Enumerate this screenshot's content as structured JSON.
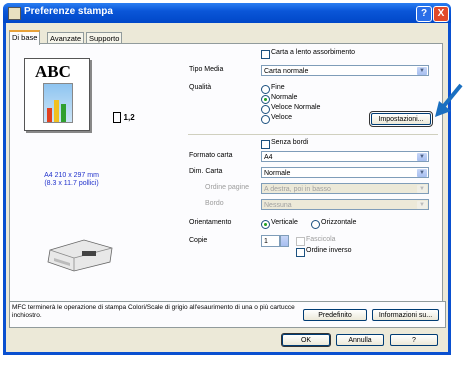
{
  "window": {
    "title": "Preferenze stampa",
    "help": "?",
    "close": "X"
  },
  "tabs": [
    {
      "label": "Di base"
    },
    {
      "label": "Avanzate"
    },
    {
      "label": "Supporto"
    }
  ],
  "preview": {
    "text": "ABC",
    "copies_badge": "1,2",
    "paper_size_line1": "A4 210 x 297 mm",
    "paper_size_line2": "(8.3 x 11.7 pollici)"
  },
  "form": {
    "slow_dry_label": "Carta a lento assorbimento",
    "media_type_label": "Tipo Media",
    "media_type_value": "Carta normale",
    "quality_label": "Qualità",
    "quality_options": [
      "Fine",
      "Normale",
      "Veloce Normale",
      "Veloce"
    ],
    "quality_selected": "Normale",
    "settings_button": "Impostazioni...",
    "borderless_label": "Senza bordi",
    "paper_format_label": "Formato carta",
    "paper_format_value": "A4",
    "page_size_label": "Dim. Carta",
    "page_size_value": "Normale",
    "page_order_label": "Ordine pagine",
    "page_order_value": "A destra, poi in basso",
    "border_label": "Bordo",
    "border_value": "Nessuna",
    "orientation_label": "Orientamento",
    "orientation_options": [
      "Verticale",
      "Orizzontale"
    ],
    "orientation_selected": "Verticale",
    "copies_label": "Copie",
    "copies_value": "1",
    "collate_label": "Fascicola",
    "reverse_order_label": "Ordine inverso"
  },
  "footer": {
    "message": "MFC terminerà le operazione di stampa Colori/Scale di grigio all'esaurimento di una o più cartucce inchiostro.",
    "default_button": "Predefinito",
    "info_button": "Informazioni su...",
    "ok_button": "OK",
    "cancel_button": "Annulla",
    "help_button": "?"
  }
}
